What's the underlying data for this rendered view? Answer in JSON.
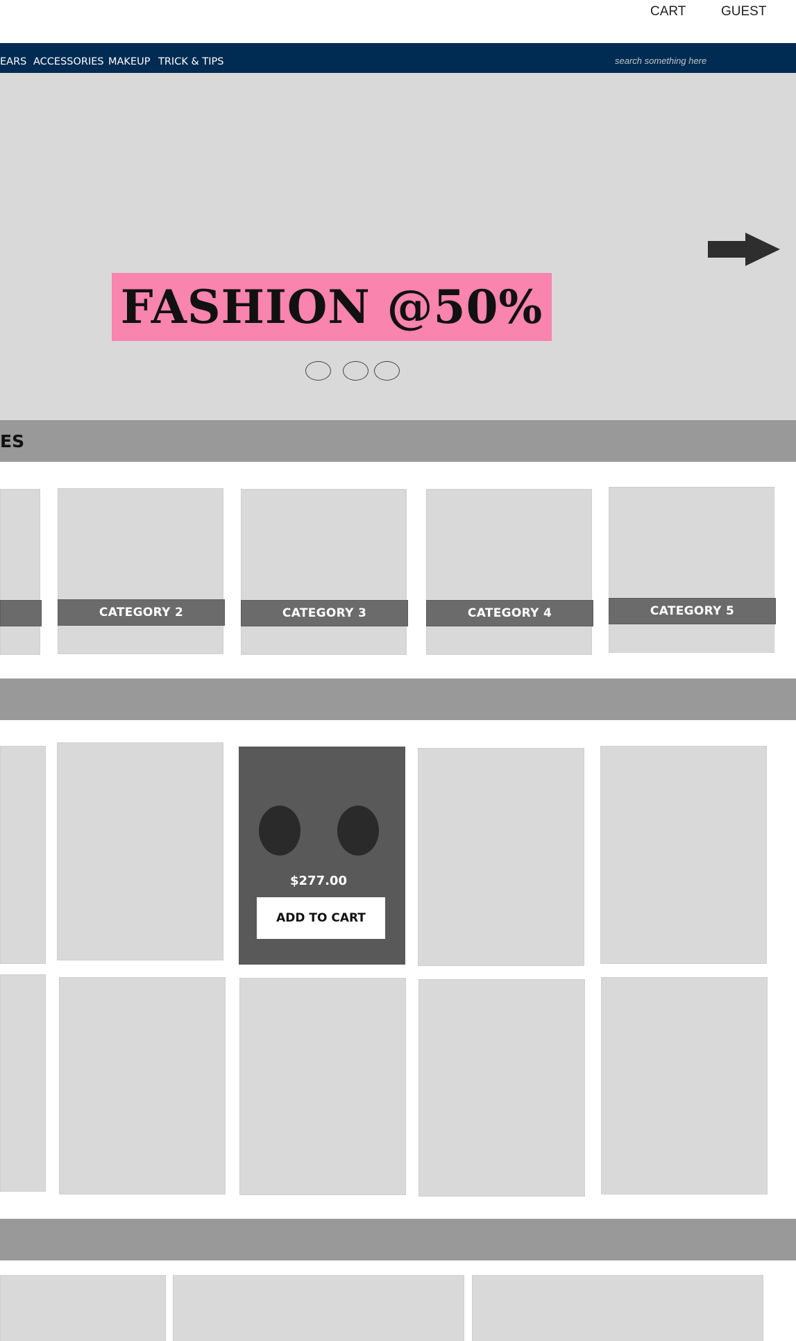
{
  "header": {
    "cart_label": "CART",
    "guest_label": "GUEST"
  },
  "nav": {
    "items": [
      "EARS",
      "ACCESSORIES",
      "MAKEUP",
      "TRICK & TIPS"
    ],
    "search_placeholder": "search something here"
  },
  "hero": {
    "promo_text": "FASHION @50%",
    "next_icon": "arrow-right-icon",
    "slide_count": 3
  },
  "categories": {
    "section_title": "ES",
    "items": [
      {
        "label": ""
      },
      {
        "label": "CATEGORY 2"
      },
      {
        "label": "CATEGORY 3"
      },
      {
        "label": "CATEGORY 4"
      },
      {
        "label": "CATEGORY 5"
      }
    ]
  },
  "products": {
    "featured": {
      "price": "$277.00",
      "add_to_cart_label": "ADD TO CART"
    }
  },
  "colors": {
    "navbar": "#002b52",
    "promo": "#f984ad",
    "section_bar": "#999999",
    "placeholder": "#d9d9d9",
    "category_label": "#6b6b6b",
    "featured_card": "#595959"
  }
}
